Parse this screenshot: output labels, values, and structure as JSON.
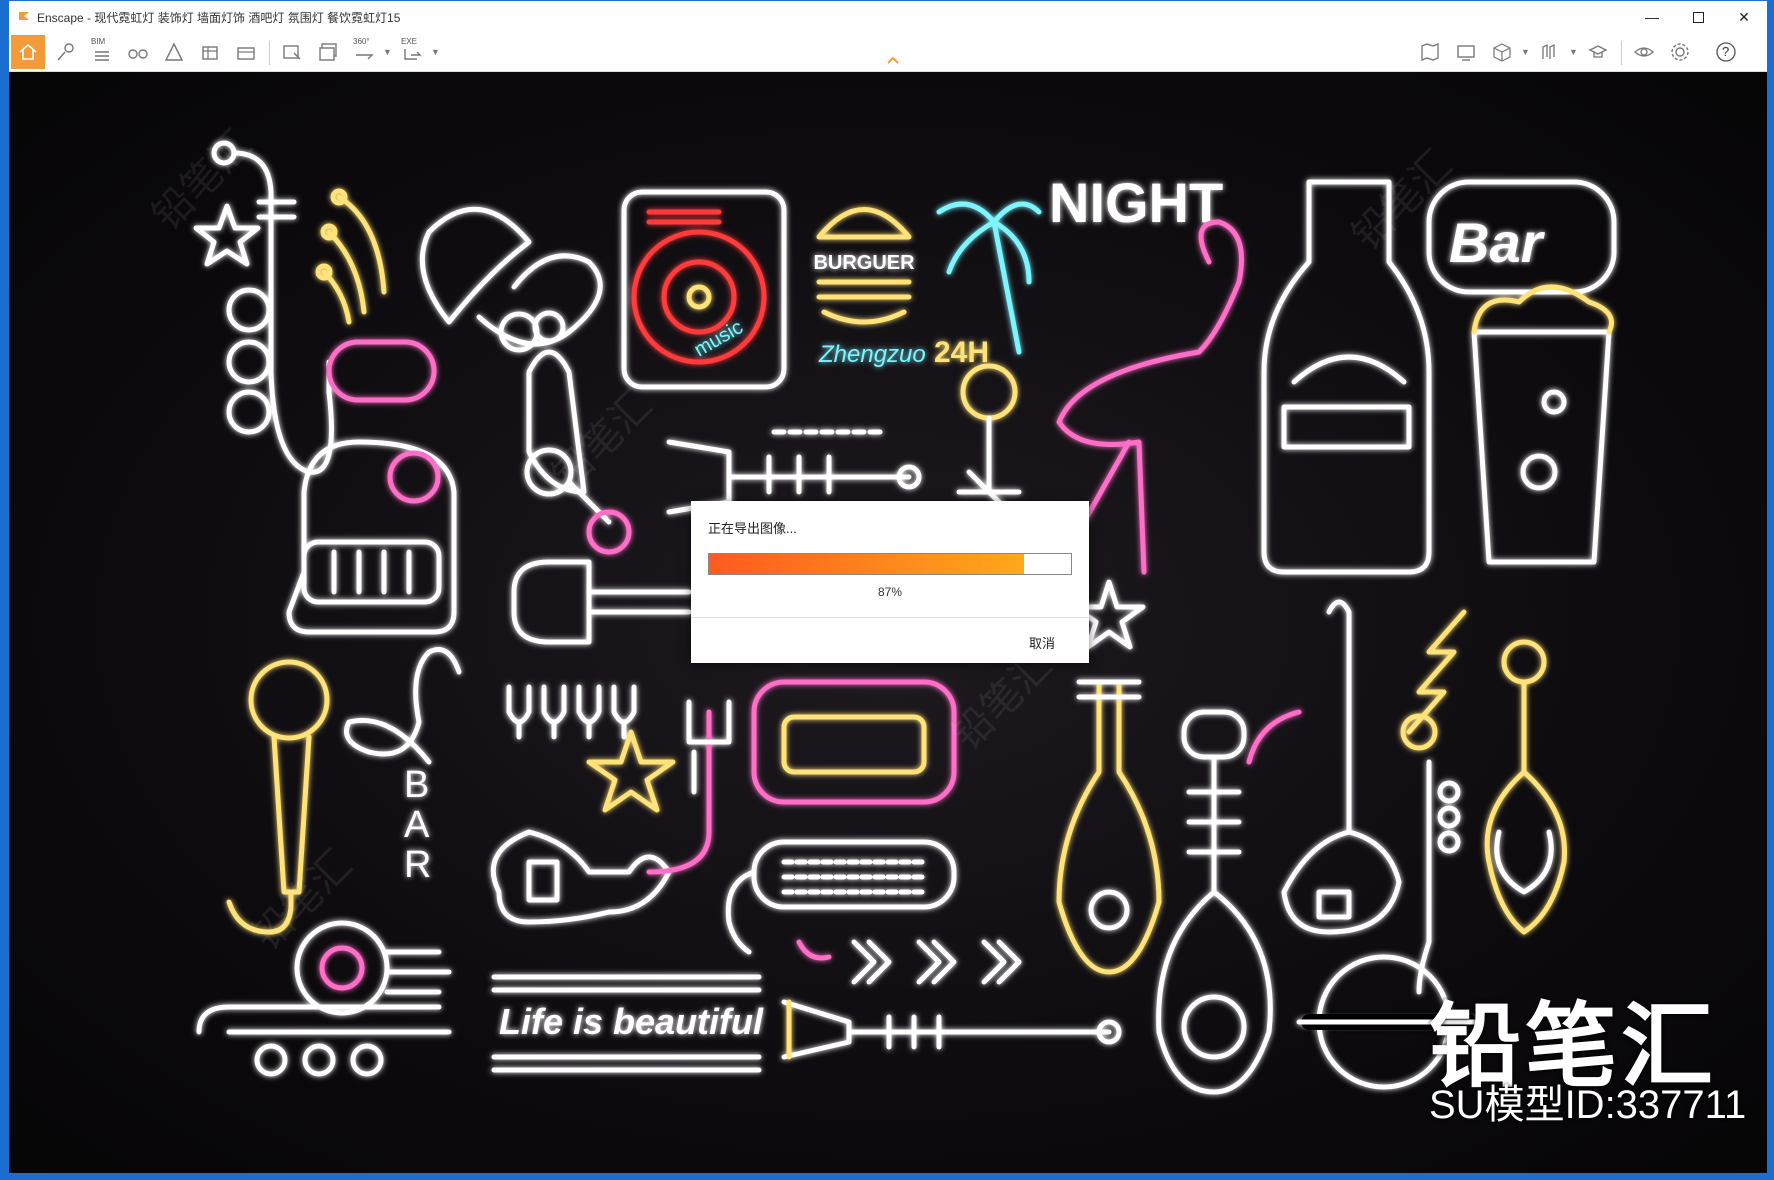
{
  "window": {
    "app_title": "Enscape - 现代霓虹灯 装饰灯 墙面灯饰 酒吧灯 氛围灯 餐饮霓虹灯15",
    "minimize_icon": "minimize-icon",
    "maximize_icon": "maximize-icon",
    "close_icon": "close-icon"
  },
  "toolbar": {
    "left": [
      "home-icon",
      "asset-library-icon",
      "bim-icon",
      "binoculars-icon",
      "walk-mode-icon",
      "view-management-icon",
      "batch-render-icon",
      "screenshot-icon",
      "render-export-icon",
      "panorama-icon",
      "exe-export-icon"
    ],
    "bim_label": "BIM",
    "panorama_label": "360°",
    "exe_label": "EXE",
    "right": [
      "map-icon",
      "screen-icon",
      "cube-icon",
      "atlas-icon",
      "hat-icon",
      "visual-settings-icon",
      "settings-icon",
      "help-icon"
    ],
    "help_label": "?"
  },
  "scene": {
    "neon_night": "NIGHT",
    "neon_burger": "BURGUER",
    "neon_24h": "24H",
    "neon_zhengzuo": "Zhengzuo",
    "neon_music": "music",
    "neon_bar_sign": "Bar",
    "neon_bar_vertical": [
      "B",
      "A",
      "R"
    ],
    "neon_life": "Life is beautiful",
    "brand_watermark": "铅笔汇",
    "model_id": "SU模型ID:337711"
  },
  "export_dialog": {
    "title": "正在导出图像...",
    "progress": 0.87,
    "percent_text": "87%",
    "cancel_label": "取消"
  },
  "colors": {
    "accent": "#f39a3a",
    "progress_start": "#ff5a1f",
    "progress_end": "#ffa91a",
    "neon_white": "#ffffff",
    "neon_pink": "#ff6ec7",
    "neon_yellow": "#ffe27a",
    "neon_cyan": "#7ef4ff",
    "neon_red": "#ff3b3b"
  }
}
